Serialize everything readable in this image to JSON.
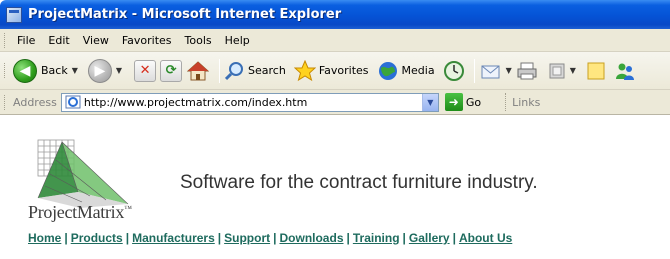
{
  "window": {
    "title": "ProjectMatrix - Microsoft Internet Explorer"
  },
  "menu": {
    "items": [
      "File",
      "Edit",
      "View",
      "Favorites",
      "Tools",
      "Help"
    ]
  },
  "toolbar": {
    "back_label": "Back",
    "search_label": "Search",
    "favorites_label": "Favorites",
    "media_label": "Media"
  },
  "addressbar": {
    "label": "Address",
    "url": "http://www.projectmatrix.com/index.htm",
    "go_label": "Go",
    "links_label": "Links"
  },
  "page": {
    "logo_text": "ProjectMatrix",
    "logo_tm": "™",
    "tagline": "Software for the contract furniture industry.",
    "nav": {
      "links": [
        "Home",
        "Products",
        "Manufacturers",
        "Support",
        "Downloads",
        "Training",
        "Gallery",
        "About Us"
      ],
      "separator": "|"
    }
  },
  "colors": {
    "titlebar": "#0553d6",
    "chrome": "#ece9d8",
    "nav_link": "#1e6b5e",
    "logo_green": "#2f8a3a"
  }
}
